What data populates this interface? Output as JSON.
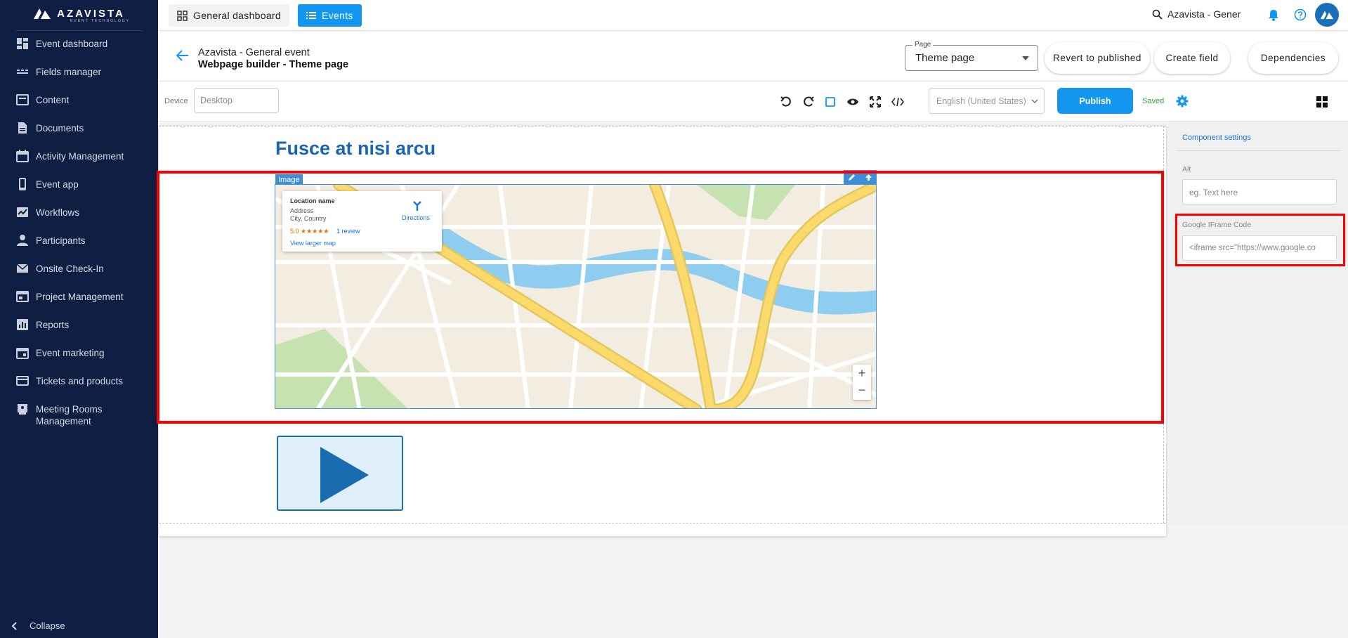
{
  "brand": {
    "name": "AZAVISTA",
    "tagline": "EVENT TECHNOLOGY"
  },
  "sidebar": {
    "items": [
      {
        "label": "Event dashboard",
        "icon": "dashboard-icon"
      },
      {
        "label": "Fields manager",
        "icon": "fields-icon"
      },
      {
        "label": "Content",
        "icon": "content-icon"
      },
      {
        "label": "Documents",
        "icon": "document-icon"
      },
      {
        "label": "Activity Management",
        "icon": "calendar-icon"
      },
      {
        "label": "Event app",
        "icon": "phone-icon"
      },
      {
        "label": "Workflows",
        "icon": "workflow-icon"
      },
      {
        "label": "Participants",
        "icon": "person-icon"
      },
      {
        "label": "Onsite Check-In",
        "icon": "mail-icon"
      },
      {
        "label": "Project Management",
        "icon": "project-icon"
      },
      {
        "label": "Reports",
        "icon": "reports-icon"
      },
      {
        "label": "Event marketing",
        "icon": "marketing-icon"
      },
      {
        "label": "Tickets and products",
        "icon": "ticket-icon"
      },
      {
        "label": "Meeting Rooms\nManagement",
        "icon": "meeting-room-icon"
      }
    ],
    "collapse_label": "Collapse"
  },
  "topbar": {
    "general_dashboard": "General dashboard",
    "events": "Events",
    "search_text": "Azavista - Gener"
  },
  "header": {
    "event_title": "Azavista - General event",
    "subtitle": "Webpage builder - Theme page",
    "page_select_legend": "Page",
    "page_select_value": "Theme page",
    "revert": "Revert to published",
    "create_field": "Create field",
    "dependencies": "Dependencies"
  },
  "toolbar": {
    "device_label": "Device",
    "device_value": "Desktop",
    "language": "English (United States)",
    "publish": "Publish",
    "status": "Saved"
  },
  "canvas": {
    "heading": "Fusce at nisi arcu",
    "image_tag": "Image",
    "map_card": {
      "location_name": "Location name",
      "address": "Address",
      "city_country": "City, Country",
      "rating": "5.0 ★★★★★",
      "reviews": "1 review",
      "view_larger": "View larger map",
      "directions": "Directions"
    },
    "zoom_in": "+",
    "zoom_out": "−"
  },
  "component_settings": {
    "title": "Component settings",
    "alt_label": "Alt",
    "alt_placeholder": "eg. Text here",
    "iframe_label": "Google IFrame Code",
    "iframe_value": "<iframe src=\"https://www.google.co"
  },
  "colors": {
    "sidebar_bg": "#0f1f44",
    "accent": "#1296f0",
    "heading": "#1a64b4",
    "highlight": "#ff0000",
    "saved": "#2ea43c"
  }
}
